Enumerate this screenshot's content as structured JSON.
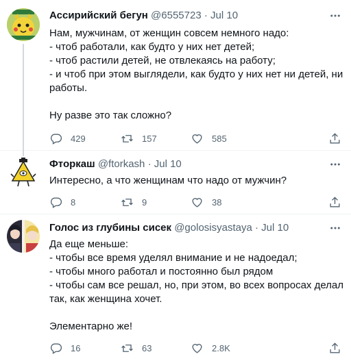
{
  "tweets": [
    {
      "name": "Ассирийский бегун",
      "handle": "@6555723",
      "sep": "·",
      "date": "Jul 10",
      "avatar_icon": "pikachu-avatar-icon",
      "lines": [
        "Нам, мужчинам, от женщин совсем немного надо:",
        "- чтоб работали, как будто у них нет детей;",
        "- чтоб растили детей, не отвлекаясь на работу;",
        "- и чтоб при этом выглядели, как будто у них нет ни детей, ни",
        "работы.",
        "",
        "Ну разве это так сложно?"
      ],
      "replies": "429",
      "retweets": "157",
      "likes": "585"
    },
    {
      "name": "Фторкаш",
      "handle": "@ftorkash",
      "sep": "·",
      "date": "Jul 10",
      "avatar_icon": "bill-cipher-avatar-icon",
      "lines": [
        "Интересно, а что женщинам что надо от мужчин?"
      ],
      "replies": "8",
      "retweets": "9",
      "likes": "38"
    },
    {
      "name": "Голос из глубины сисек",
      "handle": "@golosisyastaya",
      "sep": "·",
      "date": "Jul 10",
      "avatar_icon": "anime-avatar-icon",
      "lines": [
        "Да еще меньше:",
        "- чтобы все время уделял внимание и не надоедал;",
        "- чтобы много работал и постоянно был рядом",
        "- чтобы сам все решал, но, при этом, во всех вопросах делал",
        "так, как женщина хочет.",
        "",
        "Элементарно же!"
      ],
      "replies": "16",
      "retweets": "63",
      "likes": "2.8K"
    }
  ],
  "colors": {
    "text": "#0f1419",
    "secondary": "#536471",
    "divider": "#eff3f4",
    "thread_line": "#cfd9de"
  }
}
